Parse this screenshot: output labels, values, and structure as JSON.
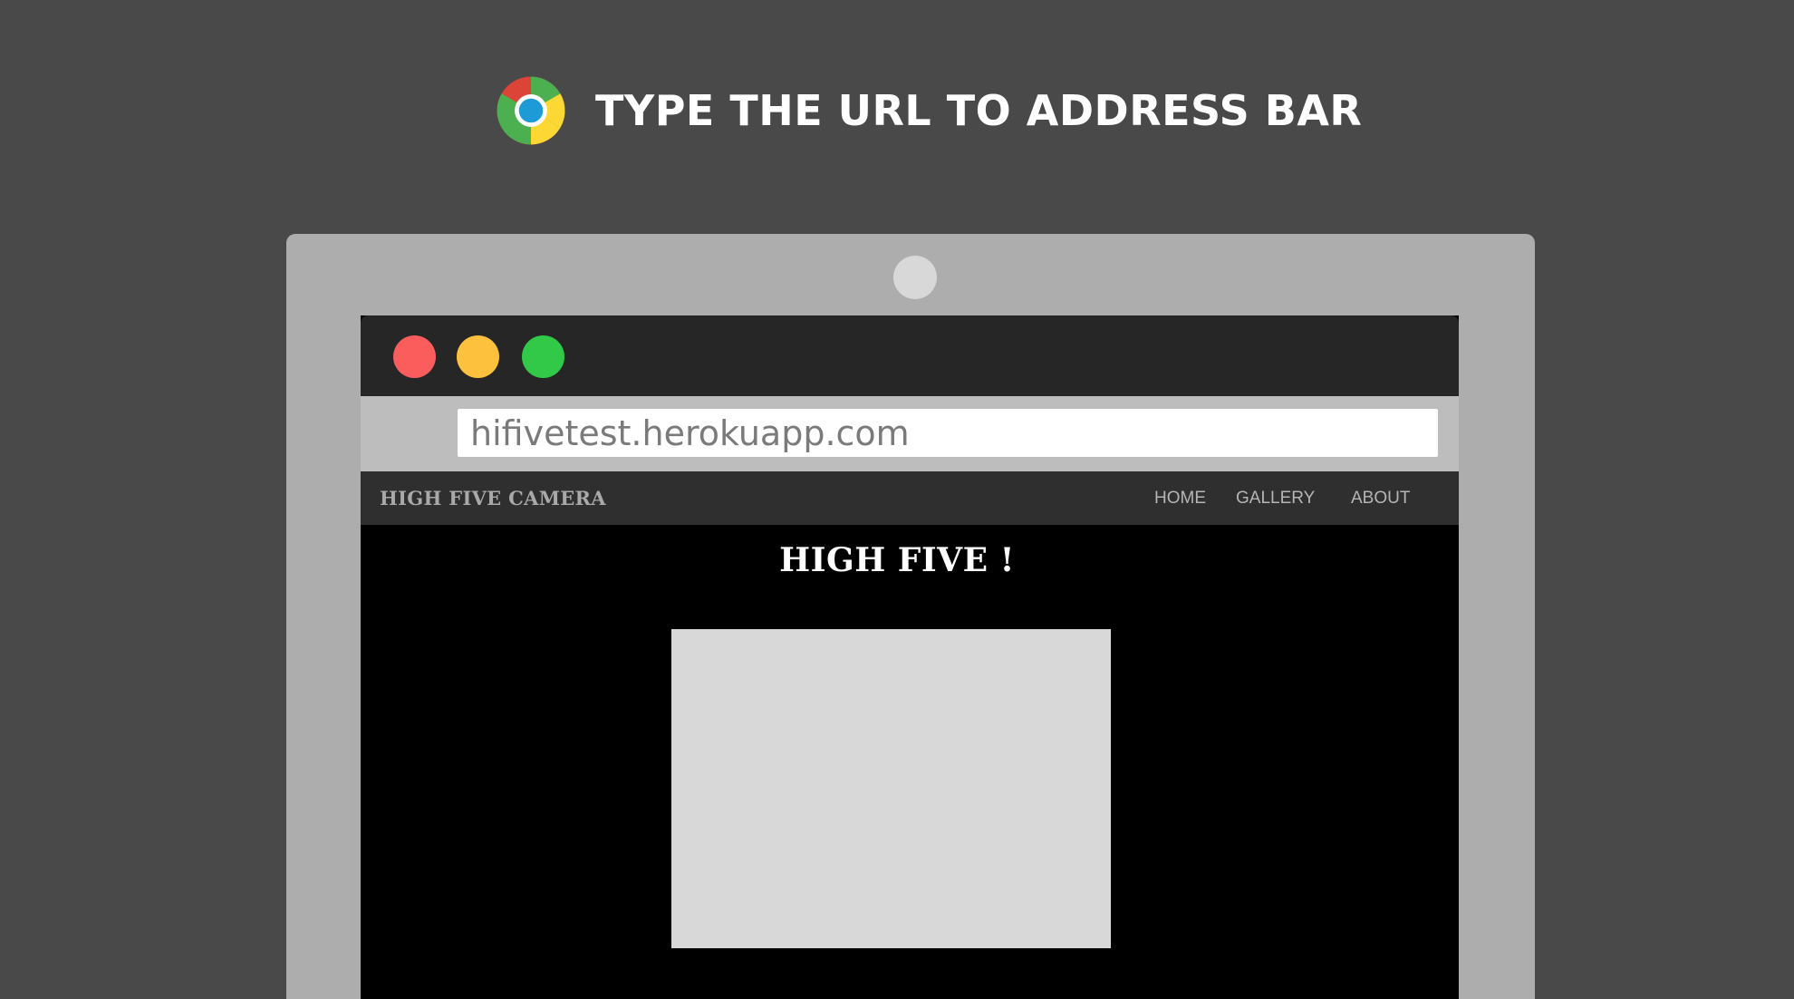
{
  "instruction": {
    "logo_icon": "chrome-logo-icon",
    "text": "TYPE THE URL TO ADDRESS BAR"
  },
  "browser": {
    "window_controls": [
      "close",
      "minimize",
      "maximize"
    ],
    "control_colors": {
      "close": "#fb5d5d",
      "minimize": "#fdc13e",
      "maximize": "#33c948"
    },
    "address_bar": {
      "value": "hifivetest.herokuapp.com"
    }
  },
  "site": {
    "brand": "HIGH FIVE CAMERA",
    "nav": {
      "home": "HOME",
      "gallery": "GALLERY",
      "about": "ABOUT"
    },
    "heading": "HIGH FIVE !"
  },
  "colors": {
    "background": "#494949",
    "laptop_frame": "#adadad",
    "titlebar": "#262626",
    "site_nav": "#2f2f2f",
    "preview": "#d8d8d8"
  }
}
